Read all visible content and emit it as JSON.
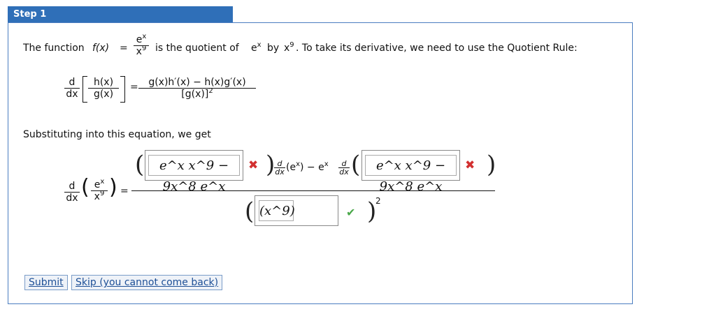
{
  "step": {
    "title": "Step 1"
  },
  "intro": {
    "prefix": "The function",
    "fx": "f(x)",
    "eq": "=",
    "num": "e",
    "num_sup": "x",
    "den": "x",
    "den_sup": "9",
    "mid": "is the quotient of",
    "e": "e",
    "e_sup": "x",
    "by": "by",
    "x": "x",
    "x_sup": "9",
    "suffix": ". To take its derivative, we need to use the Quotient Rule:"
  },
  "rule": {
    "d": "d",
    "dx": "dx",
    "hx": "h(x)",
    "gx": "g(x)",
    "eq": "=",
    "numerator": "g(x)h′(x) − h(x)g′(x)",
    "denominator": "[g(x)]",
    "den_sup": "2"
  },
  "substituting": "Substituting into this equation, we get",
  "lhs": {
    "d": "d",
    "dx": "dx",
    "num": "e",
    "num_sup": "x",
    "den": "x",
    "den_sup": "9",
    "eq": "="
  },
  "numerator": {
    "answer1": "e^x x^9 − 9x^8 e^x",
    "answer1_status": "incorrect",
    "d": "d",
    "dx": "dx",
    "middle": "(e",
    "middle_sup": "x",
    "middle_close": ") − e",
    "middle_close_sup": "x",
    "answer2": "e^x x^9 − 9x^8 e^x",
    "answer2_status": "incorrect"
  },
  "denominator": {
    "answer": "(x^9)",
    "answer_status": "correct",
    "exponent": "2"
  },
  "icons": {
    "wrong": "✖",
    "right": "✔"
  },
  "buttons": {
    "submit": "Submit",
    "skip": "Skip (you cannot come back)"
  }
}
